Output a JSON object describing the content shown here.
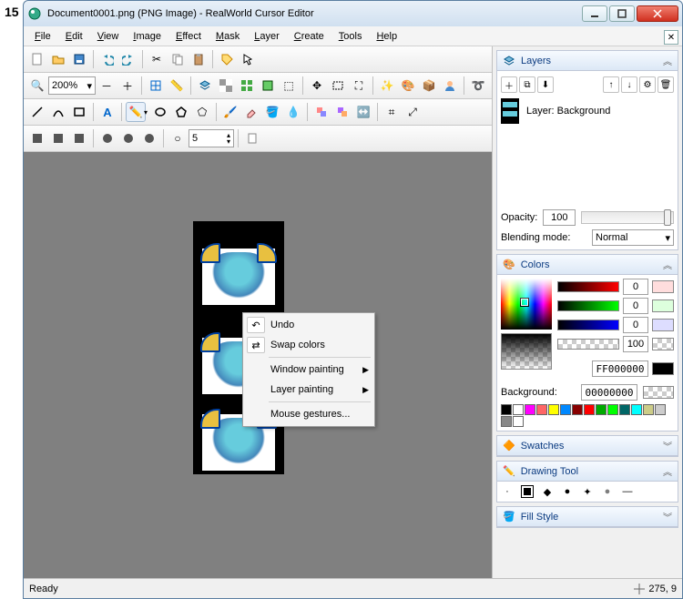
{
  "external_label": "15",
  "window": {
    "title": "Document0001.png (PNG Image) - RealWorld Cursor Editor"
  },
  "menus": [
    "File",
    "Edit",
    "View",
    "Image",
    "Effect",
    "Mask",
    "Layer",
    "Create",
    "Tools",
    "Help"
  ],
  "zoom": "200%",
  "spin_value": "5",
  "context_menu": {
    "undo": "Undo",
    "swap": "Swap colors",
    "win_paint": "Window painting",
    "layer_paint": "Layer painting",
    "gestures": "Mouse gestures..."
  },
  "panels": {
    "layers": {
      "title": "Layers",
      "item": "Layer: Background",
      "opacity_label": "Opacity:",
      "opacity_value": "100",
      "blend_label": "Blending mode:",
      "blend_value": "Normal"
    },
    "colors": {
      "title": "Colors",
      "r": "0",
      "g": "0",
      "b": "0",
      "a": "100",
      "hex": "FF000000",
      "bg_label": "Background:",
      "bg_hex": "00000000"
    },
    "swatches": {
      "title": "Swatches"
    },
    "drawing": {
      "title": "Drawing Tool"
    },
    "fill": {
      "title": "Fill Style"
    }
  },
  "status": {
    "ready": "Ready",
    "coords": "275, 9"
  },
  "palette": [
    "#000",
    "#fff",
    "#f0f",
    "#f66",
    "#ff0",
    "#08f",
    "#800",
    "#f00",
    "#0a0",
    "#0f0",
    "#066",
    "#0ff",
    "#cc8",
    "#ccc",
    "#888",
    "#fff"
  ]
}
